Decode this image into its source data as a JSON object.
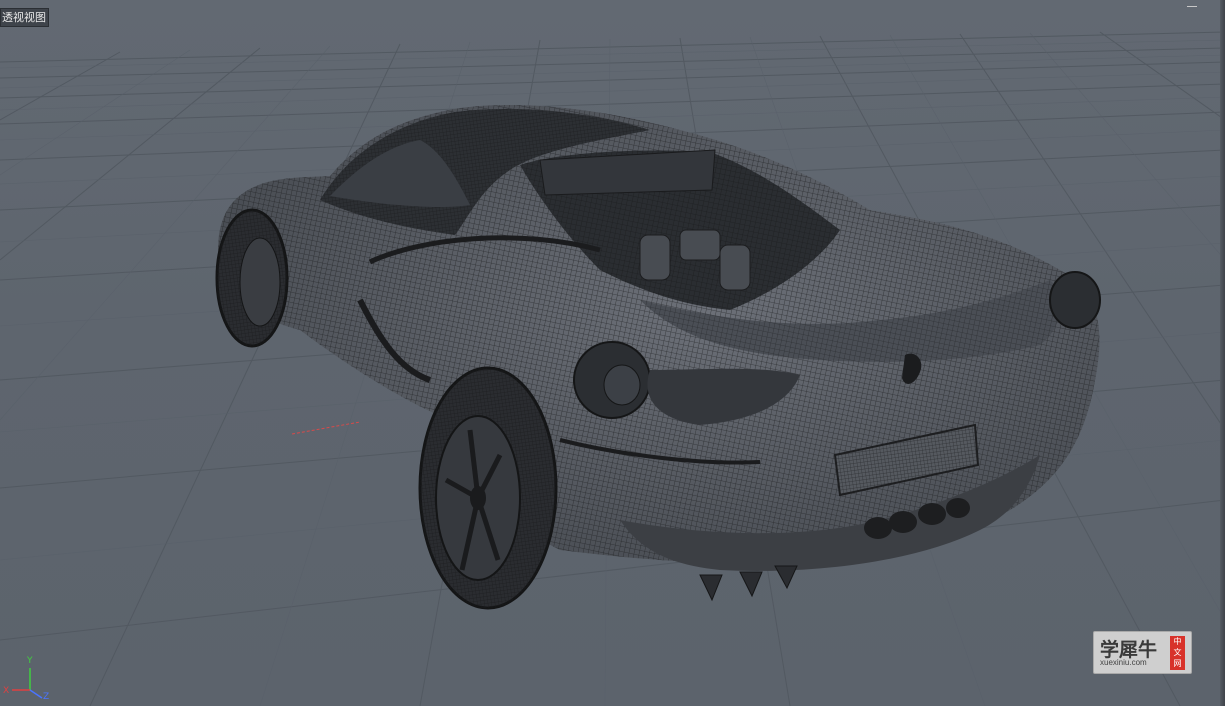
{
  "viewport": {
    "view_label": "透视视图",
    "background": "#5f6670",
    "grid_color": "#4f565e",
    "model": "sports-car-wireframe-rear-view"
  },
  "axis_gizmo": {
    "y_label": "Y",
    "x_label": "X",
    "z_label": "Z",
    "colors": {
      "x": "#e04040",
      "y": "#3fcf3f",
      "z": "#4a74ff"
    }
  },
  "watermark": {
    "logo_text": "学犀牛",
    "url": "xuexiniu.com",
    "badge_chars": [
      "中",
      "文",
      "网"
    ]
  }
}
